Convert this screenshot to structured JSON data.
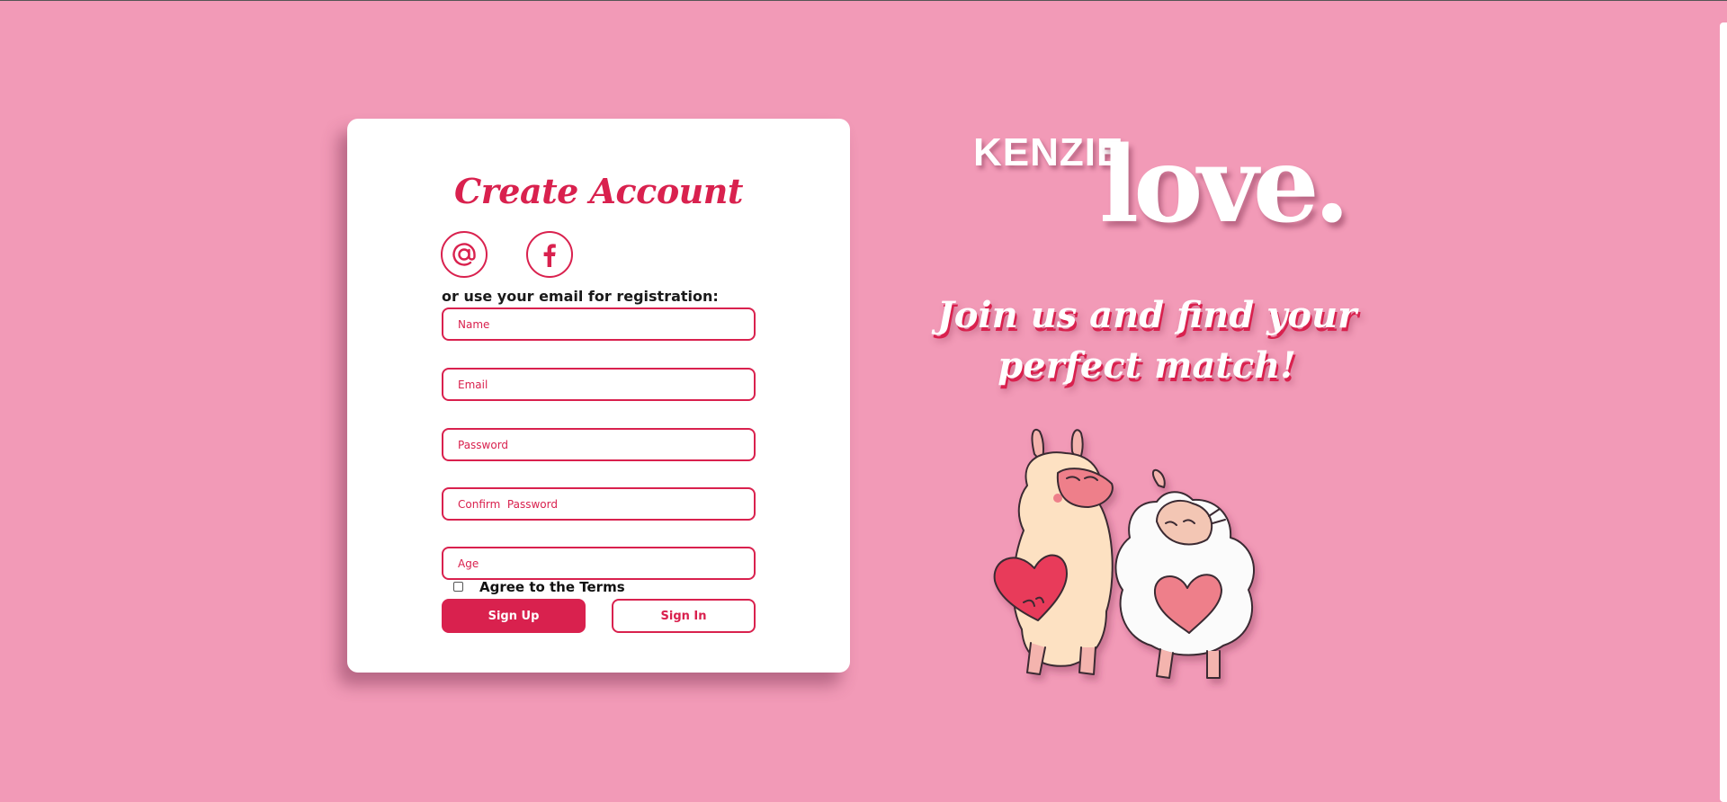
{
  "form": {
    "title": "Create Account",
    "social": [
      {
        "icon": "at-sign-icon"
      },
      {
        "icon": "facebook-icon"
      }
    ],
    "registration_hint": "or use your email for registration:",
    "fields": {
      "name": {
        "placeholder": "Name",
        "value": ""
      },
      "email": {
        "placeholder": "Email",
        "value": ""
      },
      "password": {
        "placeholder": "Password",
        "value": ""
      },
      "confirm_password": {
        "placeholder": "Confirm  Password",
        "value": ""
      },
      "age": {
        "placeholder": "Age",
        "value": ""
      }
    },
    "terms": {
      "label": "Agree to the Terms",
      "checked": false
    },
    "sign_up_label": "Sign Up",
    "sign_in_label": "Sign In"
  },
  "brand": {
    "kenzie": "KENZIE",
    "love": "love."
  },
  "tagline": {
    "line1": "Join us and find your",
    "line2": "perfect match!"
  },
  "colors": {
    "background": "#f29ab7",
    "accent": "#d9214e",
    "card": "#ffffff"
  },
  "illustration": {
    "icon": "llama-and-sheep-couple-illustration"
  }
}
